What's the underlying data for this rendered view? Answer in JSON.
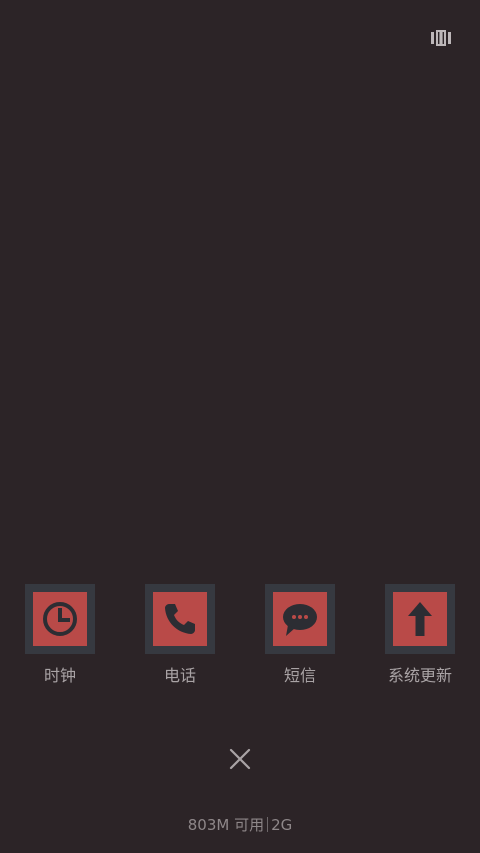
{
  "colors": {
    "background": "#2c2427",
    "tile_frame": "#363940",
    "tile_fill": "#b94a48",
    "icon": "#2c2d33",
    "label": "#a9a3a5"
  },
  "top_bar": {
    "layout_toggle_icon": "grid-layout-icon"
  },
  "recent_apps": [
    {
      "label": "时钟",
      "icon": "clock-icon"
    },
    {
      "label": "电话",
      "icon": "phone-icon"
    },
    {
      "label": "短信",
      "icon": "message-icon"
    },
    {
      "label": "系统更新",
      "icon": "update-arrow-icon"
    }
  ],
  "close_all": {
    "icon": "close-icon"
  },
  "memory": {
    "available": "803M 可用",
    "total": "2G"
  }
}
